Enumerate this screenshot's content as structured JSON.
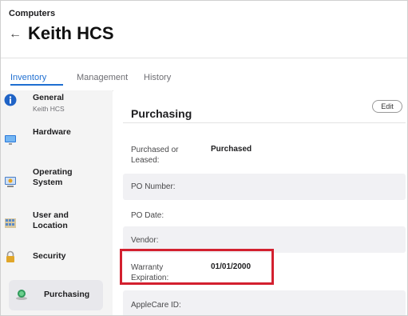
{
  "header": {
    "breadcrumb": "Computers",
    "back_icon": "←",
    "title": "Keith HCS"
  },
  "tabs": [
    {
      "label": "Inventory",
      "active": true
    },
    {
      "label": "Management",
      "active": false
    },
    {
      "label": "History",
      "active": false
    }
  ],
  "sidebar": {
    "items": [
      {
        "label": "General",
        "sublabel": "Keith HCS",
        "icon": "info-icon"
      },
      {
        "label": "Hardware",
        "icon": "monitor-icon"
      },
      {
        "label": "Operating",
        "label2": "System",
        "icon": "os-icon"
      },
      {
        "label": "User and",
        "label2": "Location",
        "icon": "user-location-icon"
      },
      {
        "label": "Security",
        "icon": "lock-icon"
      },
      {
        "label": "Purchasing",
        "icon": "purchasing-icon",
        "active": true
      }
    ]
  },
  "main": {
    "section_title": "Purchasing",
    "edit_label": "Edit",
    "fields": [
      {
        "label": "Purchased or",
        "label2": "Leased:",
        "value": "Purchased"
      },
      {
        "label": "PO Number:",
        "value": ""
      },
      {
        "label": "PO Date:",
        "value": ""
      },
      {
        "label": "Vendor:",
        "value": ""
      },
      {
        "label": "Warranty",
        "label2": "Expiration:",
        "value": "01/01/2000"
      },
      {
        "label": "AppleCare ID:",
        "value": ""
      }
    ]
  },
  "colors": {
    "accent": "#1f6fd1",
    "highlight": "#d3202f"
  }
}
